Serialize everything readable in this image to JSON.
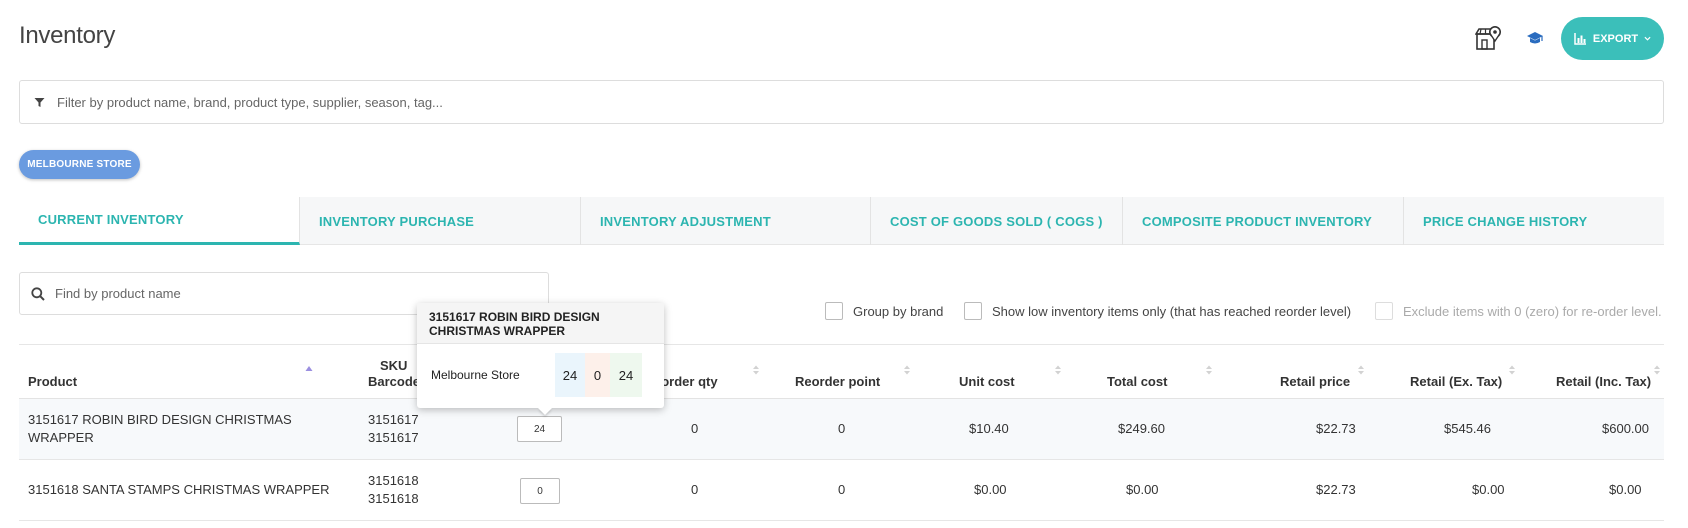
{
  "page": {
    "title": "Inventory"
  },
  "header": {
    "export_label": "EXPORT"
  },
  "filter": {
    "placeholder": "Filter by product name, brand, product type, supplier, season, tag..."
  },
  "store_chip": "MELBOURNE STORE",
  "tabs": [
    {
      "label": "CURRENT INVENTORY",
      "active": true
    },
    {
      "label": "INVENTORY PURCHASE"
    },
    {
      "label": "INVENTORY ADJUSTMENT"
    },
    {
      "label": "COST OF GOODS SOLD ( COGS )"
    },
    {
      "label": "COMPOSITE PRODUCT INVENTORY"
    },
    {
      "label": "PRICE CHANGE HISTORY"
    }
  ],
  "search": {
    "placeholder": "Find by product name"
  },
  "options": {
    "group_by_brand": "Group by brand",
    "show_low": "Show low inventory items only (that has reached reorder level)",
    "exclude_zero": "Exclude items with 0 (zero) for re-order level."
  },
  "columns": {
    "product": "Product",
    "sku": "SKU",
    "barcode": "Barcode",
    "reorder_qty": "eorder qty",
    "reorder_point": "Reorder point",
    "unit_cost": "Unit cost",
    "total_cost": "Total cost",
    "retail_price": "Retail price",
    "retail_ex": "Retail (Ex. Tax)",
    "retail_inc": "Retail (Inc. Tax)"
  },
  "rows": [
    {
      "product_line1": "3151617 ROBIN BIRD DESIGN CHRISTMAS",
      "product_line2": "WRAPPER",
      "sku": "3151617",
      "barcode": "3151617",
      "qty": "24",
      "reorder_qty": "0",
      "reorder_point": "0",
      "unit_cost": "$10.40",
      "total_cost": "$249.60",
      "retail_price": "$22.73",
      "retail_ex": "$545.46",
      "retail_inc": "$600.00"
    },
    {
      "product_line1": "3151618 SANTA STAMPS CHRISTMAS WRAPPER",
      "product_line2": "",
      "sku": "3151618",
      "barcode": "3151618",
      "qty": "0",
      "reorder_qty": "0",
      "reorder_point": "0",
      "unit_cost": "$0.00",
      "total_cost": "$0.00",
      "retail_price": "$22.73",
      "retail_ex": "$0.00",
      "retail_inc": "$0.00"
    }
  ],
  "tooltip": {
    "title_line1": "3151617 ROBIN BIRD DESIGN",
    "title_line2": "CHRISTMAS WRAPPER",
    "store": "Melbourne Store",
    "values": [
      "24",
      "0",
      "24"
    ]
  },
  "colors": {
    "accent": "#2cb5b0",
    "export_bg": "#3bbfba",
    "chip_bg": "#6a9be0",
    "tooltip_cell_blue": "#eaf5fc",
    "tooltip_cell_orange": "#fdf0ea",
    "tooltip_cell_green": "#eef8ee"
  }
}
